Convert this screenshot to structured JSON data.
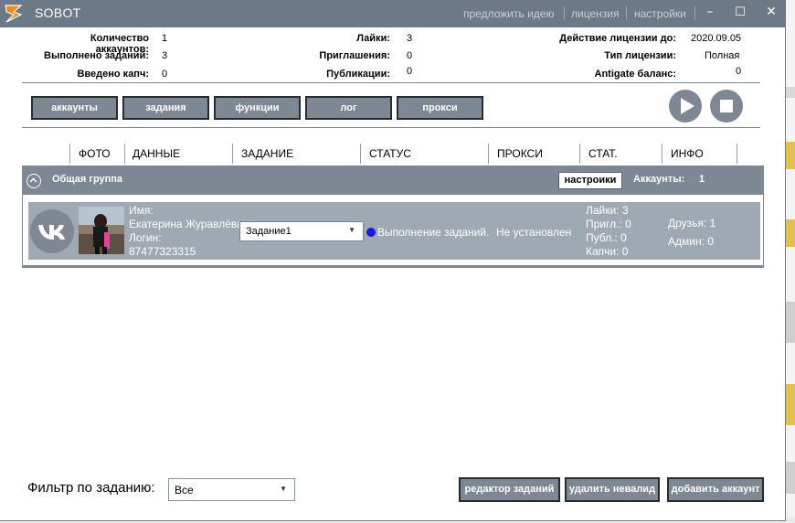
{
  "titlebar": {
    "app_title": "SOBOT",
    "links": [
      "предложить идею",
      "лицензия",
      "настройки"
    ],
    "minimize": "–",
    "maximize": "☐",
    "close": "✕"
  },
  "stats": {
    "accounts_label": "Количество аккаунтов:",
    "accounts_value": "1",
    "done_label": "Выполнено заданий:",
    "done_value": "3",
    "captcha_label": "Введено капч:",
    "captcha_value": "0",
    "likes_label": "Лайки:",
    "likes_value": "3",
    "invites_label": "Приглашения:",
    "invites_value": "0",
    "posts_label": "Публикации:",
    "posts_value": "0",
    "license_until_label": "Действие лицензии до:",
    "license_until_value": "2020.09.05",
    "license_type_label": "Тип лицензии:",
    "license_type_value": "Полная",
    "antigate_label": "Antigate баланс:",
    "antigate_value": "0"
  },
  "tabs": [
    "аккаунты",
    "задания",
    "функции",
    "лог",
    "прокси"
  ],
  "columns": [
    "ФОТО",
    "ДАННЫЕ",
    "ЗАДАНИЕ",
    "СТАТУС",
    "ПРОКСИ",
    "СТАТ.",
    "ИНФО"
  ],
  "group": {
    "title": "Общая группа",
    "settings_button": "настроики",
    "accounts_label": "Аккаунты:",
    "accounts_value": "1"
  },
  "account": {
    "name_label": "Имя:",
    "name_value": "Екатерина Журавлёва",
    "login_label": "Логин:",
    "login_value": "87477323315",
    "task": "Задание1",
    "status": "Выполнение заданий.",
    "proxy": "Не установлен",
    "stats": {
      "likes": "Лайки:  3",
      "invites": "Пригл.: 0",
      "posts": "Публ.:  0",
      "captcha": "Капчи:  0"
    },
    "friends": "Друзья: 1",
    "admin": "Админ:  0"
  },
  "filter": {
    "label": "Фильтр по заданию:",
    "value": "Все"
  },
  "buttons": {
    "task_editor": "редактор заданий",
    "delete_invalid": "удалить невалид",
    "add_account": "добавить аккаунт"
  },
  "colors": {
    "titlebar": "#6d7986",
    "accent_gray": "#7d8894",
    "row_bg": "#9fa9b3",
    "status_dot": "#1a1ae0",
    "logo_orange": "#f08a1c"
  }
}
